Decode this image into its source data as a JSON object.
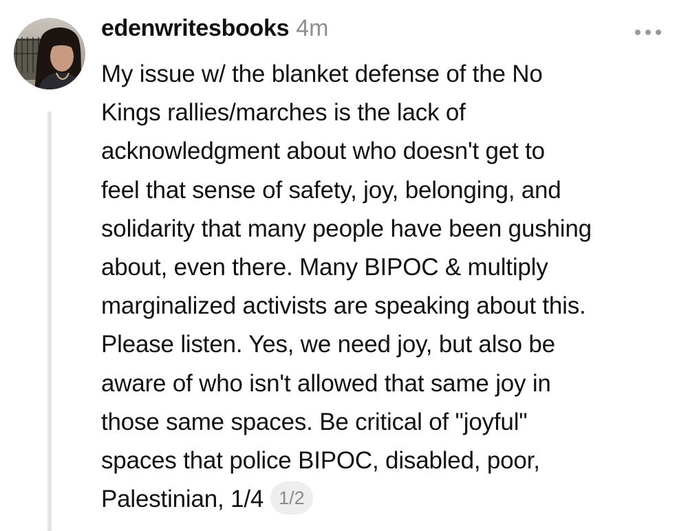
{
  "post": {
    "author": "edenwritesbooks",
    "timestamp": "4m",
    "more_icon": "more-horizontal-icon",
    "body_lines": [
      "My issue w/ the blanket defense of the No",
      "Kings rallies/marches is the lack of",
      "acknowledgment about who doesn't get to",
      "feel that sense of safety, joy, belonging, and",
      "solidarity that many people have been gushing",
      "about, even there. Many BIPOC & multiply",
      "marginalized activists are speaking about this.",
      "Please listen. Yes, we need joy, but also be",
      "aware of who isn't allowed that same joy in",
      "those same spaces. Be critical of \"joyful\"",
      "spaces that police BIPOC, disabled, poor,",
      "Palestinian, 1/4"
    ],
    "page_indicator": "1/2"
  },
  "colors": {
    "text": "#111111",
    "muted": "#8e8e8e",
    "thread_line": "#e4e4e4",
    "pill_background": "#eeeeee"
  }
}
